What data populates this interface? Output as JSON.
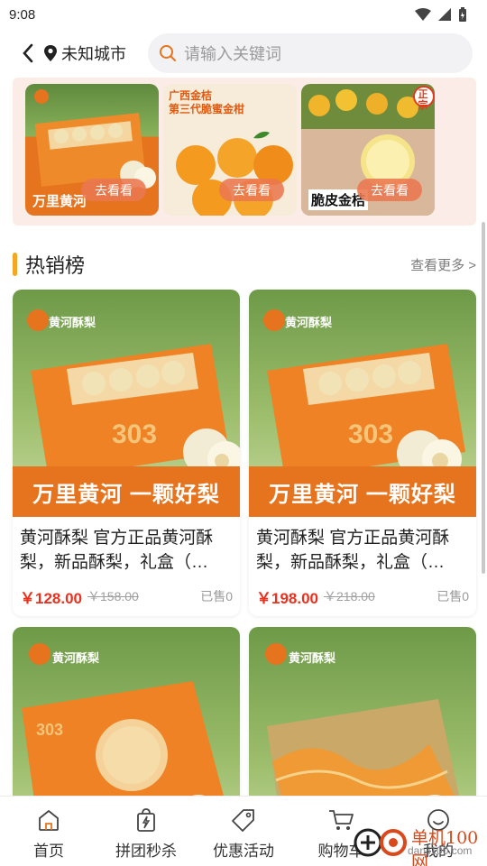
{
  "status_bar": {
    "time": "9:08"
  },
  "header": {
    "city": "未知城市",
    "search_placeholder": "请输入关键词"
  },
  "promos": [
    {
      "button": "去看看",
      "caption": "万里黄河",
      "overlay_text": ""
    },
    {
      "button": "去看看",
      "caption": "",
      "overlay_text": "广西金桔\n第三代脆蜜金柑"
    },
    {
      "button": "去看看",
      "caption": "脆皮金桔",
      "badge": "正宗"
    }
  ],
  "section": {
    "title": "热销榜",
    "more": "查看更多 >"
  },
  "products": [
    {
      "title": "黄河酥梨 官方正品黄河酥梨，新品酥梨，礼盒（…",
      "price": "￥128.00",
      "old_price": "￥158.00",
      "sold": "已售0",
      "image_caption": "万里黄河 一颗好梨",
      "brand": "黄河酥梨"
    },
    {
      "title": "黄河酥梨 官方正品黄河酥梨，新品酥梨，礼盒（…",
      "price": "￥198.00",
      "old_price": "￥218.00",
      "sold": "已售0",
      "image_caption": "万里黄河 一颗好梨",
      "brand": "黄河酥梨"
    },
    {
      "title": "",
      "price": "",
      "old_price": "",
      "sold": "",
      "image_caption": "",
      "brand": "黄河酥梨"
    },
    {
      "title": "",
      "price": "",
      "old_price": "",
      "sold": "",
      "image_caption": "",
      "brand": "黄河酥梨"
    }
  ],
  "nav": [
    {
      "label": "首页",
      "icon": "home-icon"
    },
    {
      "label": "拼团秒杀",
      "icon": "flash-bag-icon"
    },
    {
      "label": "优惠活动",
      "icon": "tag-icon"
    },
    {
      "label": "购物车",
      "icon": "cart-icon"
    },
    {
      "label": "我的",
      "icon": "smile-icon"
    }
  ],
  "watermark": {
    "title": "单机100网",
    "url": "danji100.com"
  },
  "colors": {
    "accent_orange": "#e6731e",
    "price_red": "#e8321f",
    "section_bar": "#f5a623",
    "promo_bg": "#fcece8"
  }
}
